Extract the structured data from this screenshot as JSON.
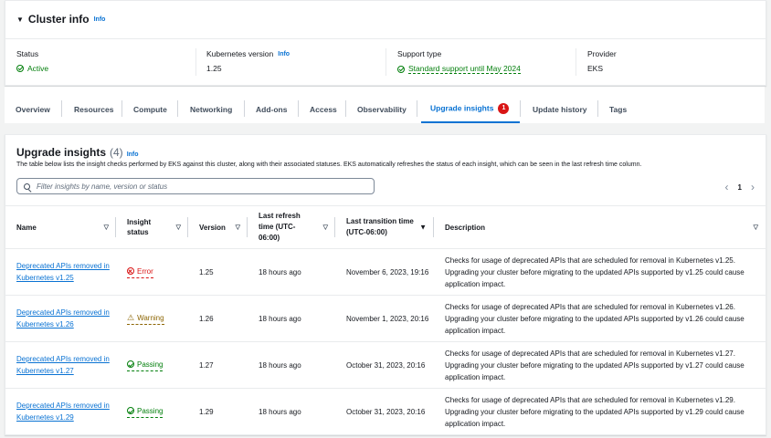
{
  "cluster_info": {
    "title": "Cluster info",
    "info": "Info",
    "status_label": "Status",
    "status_value": "Active",
    "k8s_label": "Kubernetes version",
    "k8s_info": "Info",
    "k8s_value": "1.25",
    "support_label": "Support type",
    "support_value": "Standard support until May 2024",
    "provider_label": "Provider",
    "provider_value": "EKS"
  },
  "tabs": [
    "Overview",
    "Resources",
    "Compute",
    "Networking",
    "Add-ons",
    "Access",
    "Observability",
    "Upgrade insights",
    "Update history",
    "Tags"
  ],
  "active_tab": "Upgrade insights",
  "tab_badge": "1",
  "insights": {
    "title": "Upgrade insights",
    "count": "(4)",
    "info": "Info",
    "description": "The table below lists the insight checks performed by EKS against this cluster, along with their associated statuses. EKS automatically refreshes the status of each insight, which can be seen in the last refresh time column.",
    "search_placeholder": "Filter insights by name, version or status",
    "page": "1",
    "columns": [
      "Name",
      "Insight status",
      "Version",
      "Last refresh time (UTC-06:00)",
      "Last transition time (UTC-06:00)",
      "Description"
    ],
    "rows": [
      {
        "name": "Deprecated APIs removed in Kubernetes v1.25",
        "status": "Error",
        "version": "1.25",
        "refresh": "18 hours ago",
        "transition": "November 6, 2023, 19:16",
        "description": "Checks for usage of deprecated APIs that are scheduled for removal in Kubernetes v1.25. Upgrading your cluster before migrating to the updated APIs supported by v1.25 could cause application impact."
      },
      {
        "name": "Deprecated APIs removed in Kubernetes v1.26",
        "status": "Warning",
        "version": "1.26",
        "refresh": "18 hours ago",
        "transition": "November 1, 2023, 20:16",
        "description": "Checks for usage of deprecated APIs that are scheduled for removal in Kubernetes v1.26. Upgrading your cluster before migrating to the updated APIs supported by v1.26 could cause application impact."
      },
      {
        "name": "Deprecated APIs removed in Kubernetes v1.27",
        "status": "Passing",
        "version": "1.27",
        "refresh": "18 hours ago",
        "transition": "October 31, 2023, 20:16",
        "description": "Checks for usage of deprecated APIs that are scheduled for removal in Kubernetes v1.27. Upgrading your cluster before migrating to the updated APIs supported by v1.27 could cause application impact."
      },
      {
        "name": "Deprecated APIs removed in Kubernetes v1.29",
        "status": "Passing",
        "version": "1.29",
        "refresh": "18 hours ago",
        "transition": "October 31, 2023, 20:16",
        "description": "Checks for usage of deprecated APIs that are scheduled for removal in Kubernetes v1.29. Upgrading your cluster before migrating to the updated APIs supported by v1.29 could cause application impact."
      }
    ]
  }
}
